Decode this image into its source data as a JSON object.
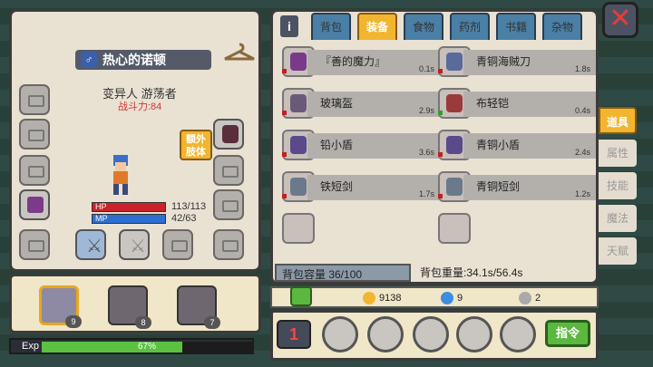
{
  "character": {
    "name": "热心的诺顿",
    "gender_symbol": "♂",
    "class": "变异人 游荡者",
    "power": "战斗力:84",
    "hp_label": "HP",
    "hp": "113/113",
    "mp_label": "MP",
    "mp": "42/63",
    "extra_limb": "额外肢体"
  },
  "party": [
    {
      "level": "9"
    },
    {
      "level": "8"
    },
    {
      "level": "7"
    }
  ],
  "exp": {
    "label": "Exp",
    "percent": "67%",
    "fraction": 0.67
  },
  "tabs": [
    "背包",
    "装备",
    "食物",
    "药剂",
    "书籍",
    "杂物"
  ],
  "active_tab": "装备",
  "items": [
    {
      "name": "『善的魔力』",
      "weight": "0.1s"
    },
    {
      "name": "青铜海贼刀",
      "weight": "1.8s"
    },
    {
      "name": "玻璃盔",
      "weight": "2.9s"
    },
    {
      "name": "布轻铠",
      "weight": "0.4s"
    },
    {
      "name": "铅小盾",
      "weight": "3.6s"
    },
    {
      "name": "青铜小盾",
      "weight": "2.4s"
    },
    {
      "name": "铁短剑",
      "weight": "1.7s"
    },
    {
      "name": "青铜短剑",
      "weight": "1.2s"
    }
  ],
  "capacity": "背包容量 36/100",
  "weight": "背包重量:34.1s/56.4s",
  "side_tabs": [
    "道具",
    "属性",
    "技能",
    "魔法",
    "天赋"
  ],
  "currency": {
    "gold": "9138",
    "gem": "9",
    "silver": "2"
  },
  "command": "指令",
  "info": "i",
  "close": "✕",
  "page_num": "1"
}
